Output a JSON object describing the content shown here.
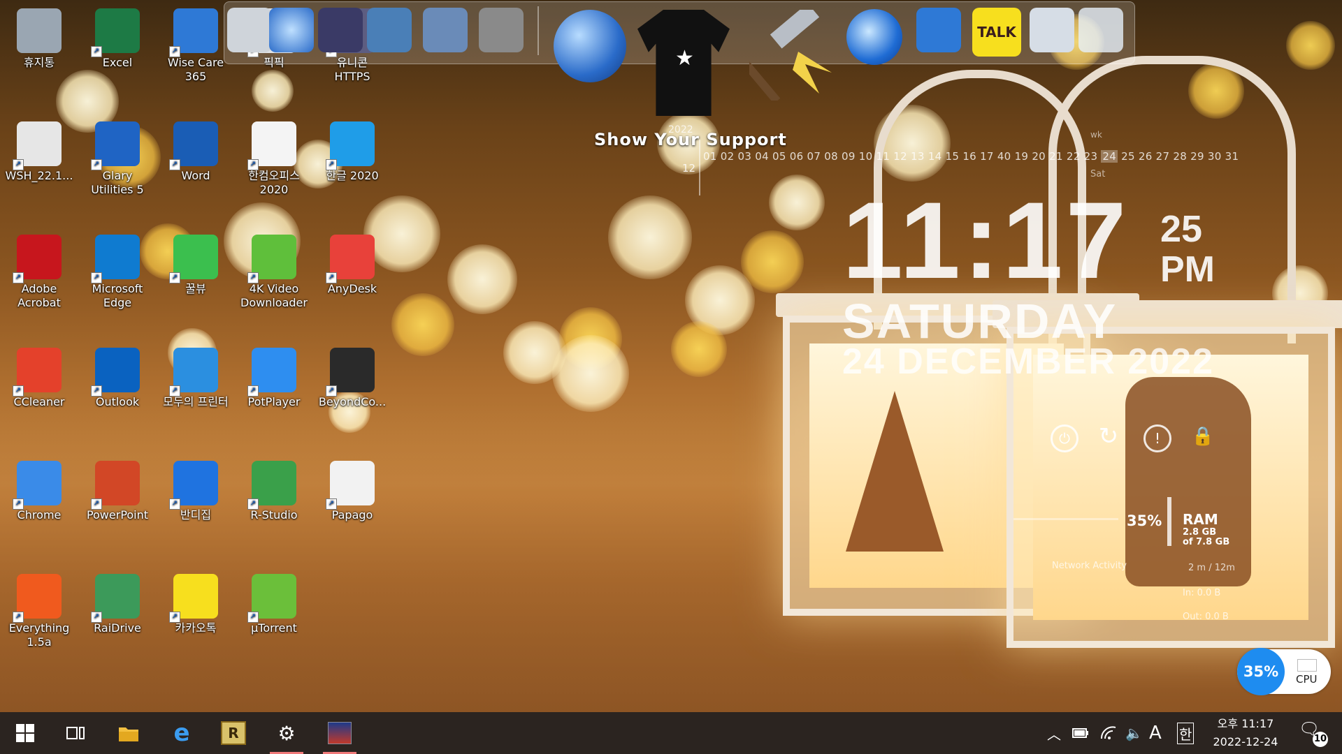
{
  "desktop_icons": [
    {
      "label": "휴지통",
      "icon": "recycle-bin-icon",
      "color": "#9aa6b2"
    },
    {
      "label": "Excel",
      "icon": "excel-icon",
      "color": "#1d7a45"
    },
    {
      "label": "Wise Care 365",
      "icon": "wise-care-icon",
      "color": "#2e79d6"
    },
    {
      "label": "픽픽",
      "icon": "picpick-icon",
      "color": "#d9dce0"
    },
    {
      "label": "유니콘 HTTPS",
      "icon": "unicorn-https-icon",
      "color": "#3a3a66"
    },
    {
      "label": "WSH_22.1...",
      "icon": "disk-image-icon",
      "color": "#e6e6e6"
    },
    {
      "label": "Glary Utilities 5",
      "icon": "glary-utilities-icon",
      "color": "#1f64c4"
    },
    {
      "label": "Word",
      "icon": "word-icon",
      "color": "#1a5db5"
    },
    {
      "label": "한컴오피스 2020",
      "icon": "hancom-office-icon",
      "color": "#f4f4f4"
    },
    {
      "label": "한글 2020",
      "icon": "hangul-icon",
      "color": "#1f9de8"
    },
    {
      "label": "Adobe Acrobat",
      "icon": "acrobat-icon",
      "color": "#c7161d"
    },
    {
      "label": "Microsoft Edge",
      "icon": "edge-icon",
      "color": "#0f7bd0"
    },
    {
      "label": "꿀뷰",
      "icon": "honeyview-icon",
      "color": "#3bbf4e"
    },
    {
      "label": "4K Video Downloader",
      "icon": "video-downloader-icon",
      "color": "#5fbf3b"
    },
    {
      "label": "AnyDesk",
      "icon": "anydesk-icon",
      "color": "#e8413a"
    },
    {
      "label": "CCleaner",
      "icon": "ccleaner-icon",
      "color": "#e4412b"
    },
    {
      "label": "Outlook",
      "icon": "outlook-icon",
      "color": "#0a62c0"
    },
    {
      "label": "모두의 프린터",
      "icon": "printer-icon",
      "color": "#2b8fe0"
    },
    {
      "label": "PotPlayer",
      "icon": "potplayer-icon",
      "color": "#2e8ef0"
    },
    {
      "label": "BeyondCo...",
      "icon": "beyond-compare-icon",
      "color": "#2a2a2a"
    },
    {
      "label": "Chrome",
      "icon": "chrome-icon",
      "color": "#3a8be8"
    },
    {
      "label": "PowerPoint",
      "icon": "powerpoint-icon",
      "color": "#d24726"
    },
    {
      "label": "반디집",
      "icon": "bandizip-icon",
      "color": "#1f73e0"
    },
    {
      "label": "R-Studio",
      "icon": "r-studio-icon",
      "color": "#3aa04a"
    },
    {
      "label": "Papago",
      "icon": "papago-icon",
      "color": "#f2f2f2"
    },
    {
      "label": "Everything 1.5a",
      "icon": "everything-search-icon",
      "color": "#f05a1e"
    },
    {
      "label": "RaiDrive",
      "icon": "raidrive-icon",
      "color": "#3c9a5a"
    },
    {
      "label": "카카오톡",
      "icon": "kakaotalk-icon",
      "color": "#f7df1e"
    },
    {
      "label": "µTorrent",
      "icon": "utorrent-icon",
      "color": "#6bbf3a"
    }
  ],
  "dock": {
    "support_text": "Show Your Support",
    "shirt_star": "★",
    "talk_label": "TALK",
    "items": [
      "computer-icon",
      "network-globe-icon",
      "folder-icon",
      "folder-icon",
      "folder-icon",
      "tools-icon",
      "earth-icon",
      "tshirt-icon",
      "hammer-icon",
      "glary-icon",
      "wise-icon",
      "kakaotalk-icon",
      "r-icon",
      "recycle-bin-icon"
    ]
  },
  "calendar": {
    "year": "2022",
    "month": "12",
    "days_before": "01 02 03 04 05 06 07 08 09 10 11 12 13 14 15 16 17 40 19 20 21 22 23 ",
    "today": "24",
    "days_after": " 25 26 27 28 29 30 31",
    "week_label": "wk",
    "day_abbr": "Sat"
  },
  "clock": {
    "time": "11:17",
    "seconds": "25",
    "ampm": "PM",
    "weekday": "SATURDAY",
    "date": "24 DECEMBER 2022"
  },
  "power_buttons": [
    "power-icon",
    "restart-icon",
    "shutdown-icon",
    "lock-icon"
  ],
  "ram": {
    "percent": "35%",
    "label": "RAM",
    "used": "2.8 GB",
    "total": "of 7.8 GB"
  },
  "network": {
    "title": "Network Activity",
    "interval": "2 m / 12m",
    "in": "In: 0.0 B",
    "out": "Out: 0.0 B"
  },
  "cpu_widget": {
    "percent": "35%",
    "label": "CPU"
  },
  "taskbar": {
    "items": [
      "start-icon",
      "task-view-icon",
      "file-explorer-icon",
      "internet-explorer-icon",
      "r-app-icon",
      "settings-icon",
      "wallpaper-app-icon"
    ],
    "active": [
      "settings-icon",
      "wallpaper-app-icon"
    ],
    "tray": {
      "ime_lang": "A",
      "ime_mode": "한"
    },
    "clock_time": "오후 11:17",
    "clock_date": "2022-12-24",
    "notifications": "10"
  }
}
